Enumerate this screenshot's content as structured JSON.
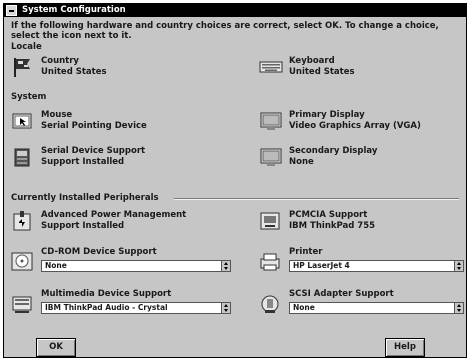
{
  "window": {
    "title": "System Configuration"
  },
  "instructions": "If the following hardware and country choices are correct, select OK. To change a choice, select the icon next to it.",
  "sections": {
    "locale": "Locale",
    "system": "System",
    "peripherals": "Currently Installed Peripherals"
  },
  "locale": {
    "country": {
      "title": "Country",
      "value": "United States"
    },
    "keyboard": {
      "title": "Keyboard",
      "value": "United States"
    }
  },
  "system": {
    "mouse": {
      "title": "Mouse",
      "value": "Serial Pointing Device"
    },
    "primary_display": {
      "title": "Primary Display",
      "value": "Video Graphics Array (VGA)"
    },
    "serial": {
      "title": "Serial Device Support",
      "value": "Support Installed"
    },
    "secondary_display": {
      "title": "Secondary Display",
      "value": "None"
    }
  },
  "peripherals": {
    "apm": {
      "title": "Advanced Power Management",
      "value": "Support Installed"
    },
    "pcmcia": {
      "title": "PCMCIA Support",
      "value": "IBM ThinkPad 755"
    },
    "cdrom": {
      "title": "CD-ROM Device Support",
      "selected": "None"
    },
    "printer": {
      "title": "Printer",
      "selected": "HP LaserJet 4"
    },
    "multimedia": {
      "title": "Multimedia Device Support",
      "selected": "IBM ThinkPad Audio - Crystal"
    },
    "scsi": {
      "title": "SCSI Adapter Support",
      "selected": "None"
    }
  },
  "buttons": {
    "ok": "OK",
    "help": "Help"
  },
  "colors": {
    "face": "#c6c6c6",
    "titlebar": "#000000"
  }
}
